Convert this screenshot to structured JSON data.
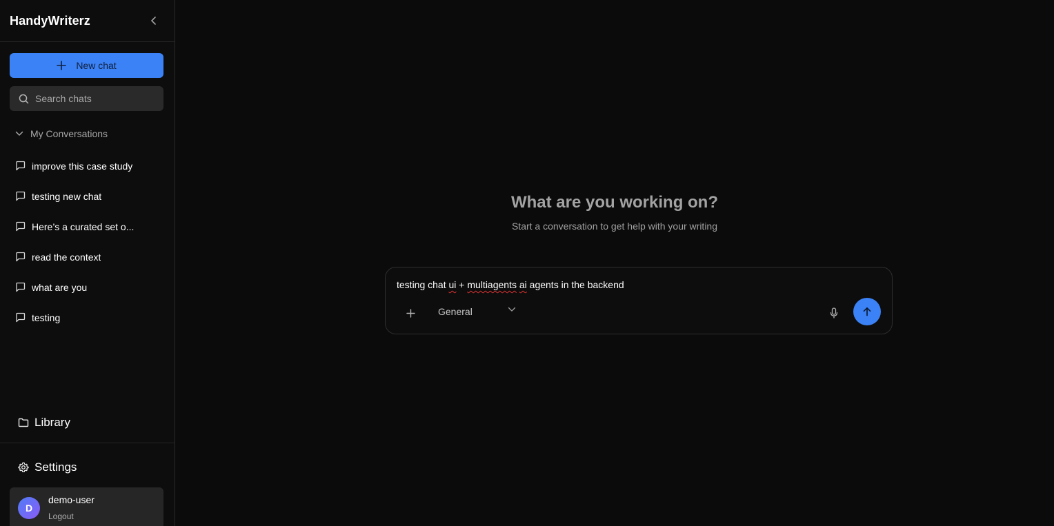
{
  "sidebar": {
    "brand": "HandyWriterz",
    "new_chat_label": "New chat",
    "search_placeholder": "Search chats",
    "section_label": "My Conversations",
    "conversations": [
      {
        "title": "improve this case study"
      },
      {
        "title": "testing new chat"
      },
      {
        "title": "Here’s a curated set o..."
      },
      {
        "title": "read the context"
      },
      {
        "title": "what are you"
      },
      {
        "title": "testing"
      }
    ],
    "library_label": "Library",
    "settings_label": "Settings",
    "user": {
      "initial": "D",
      "name": "demo-user",
      "logout_label": "Logout"
    }
  },
  "main": {
    "heading": "What are you working on?",
    "subheading": "Start a conversation to get help with your writing",
    "composer": {
      "text_parts": [
        "testing chat ",
        "ui",
        " + ",
        "multiagents",
        " ",
        "ai",
        " agents in the backend"
      ],
      "mode": "General"
    }
  },
  "colors": {
    "accent": "#3b82f6",
    "background": "#0b0b0b",
    "sidebar": "#0d0d0d"
  }
}
